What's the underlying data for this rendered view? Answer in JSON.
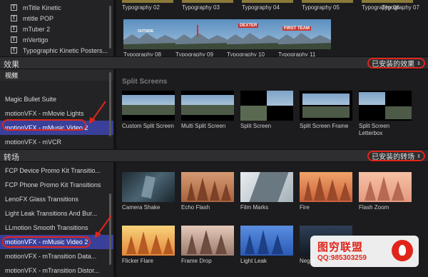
{
  "titles_browser": {
    "items": [
      "mTitle Kinetic",
      "mtitle POP",
      "mTuber 2",
      "mVertigo",
      "Typographic Kinetic Posters..."
    ],
    "thumb_labels_top": [
      "Typography 02",
      "Typography 03",
      "Typography 04",
      "Typography 05",
      "Typography 06",
      "Typography 07"
    ],
    "thumbs": [
      {
        "label": "Typography 08",
        "overlay": "OUTSIDE"
      },
      {
        "label": "Typography 09",
        "overlay": ""
      },
      {
        "label": "Typography 10",
        "overlay": "DEXTER"
      },
      {
        "label": "Typography 11",
        "overlay": "FIRST TEAM"
      }
    ]
  },
  "effects": {
    "section_title": "效果",
    "installed_label": "已安装的效果",
    "categories": {
      "header": "视频",
      "items": [
        "Magic Bullet Suite",
        "motionVFX - mMovie Lights",
        "motionVFX - mMusic Video 2",
        "motionVFX - mVCR"
      ],
      "selected": "motionVFX - mMusic Video 2"
    },
    "group_title": "Split Screens",
    "thumbs": [
      {
        "label": "Custom Split Screen"
      },
      {
        "label": "Multi Split Screen"
      },
      {
        "label": "Split Screen"
      },
      {
        "label": "Split Screen Frame"
      },
      {
        "label": "Split Screen Letterbox"
      }
    ]
  },
  "transitions": {
    "section_title": "转场",
    "installed_label": "已安装的转场",
    "categories": {
      "items": [
        "FCP Device Promo Kit Transitio...",
        "FCP Phone Promo Kit Transitions",
        "LenoFX Glass Transitions",
        "Light Leak Transitions And Bur...",
        "LLmotion Smooth Transitions",
        "motionVFX - mMusic Video 2",
        "motionVFX - mTransition Data...",
        "motionVFX - mTransition Distor..."
      ],
      "selected": "motionVFX - mMusic Video 2"
    },
    "thumbs": [
      {
        "label": "Camera Shake"
      },
      {
        "label": "Echo Flash"
      },
      {
        "label": "Film Marks"
      },
      {
        "label": "Fire"
      },
      {
        "label": "Flash Zoom"
      },
      {
        "label": "Flicker Flare"
      },
      {
        "label": "Frame Drop"
      },
      {
        "label": "Light Leak"
      },
      {
        "label": "Negat"
      }
    ]
  },
  "watermark": {
    "title": "图穷联盟",
    "qq": "QQ:985303259"
  },
  "colors": {
    "accent_red": "#e0251b",
    "selection_blue": "#3a3f9a"
  }
}
